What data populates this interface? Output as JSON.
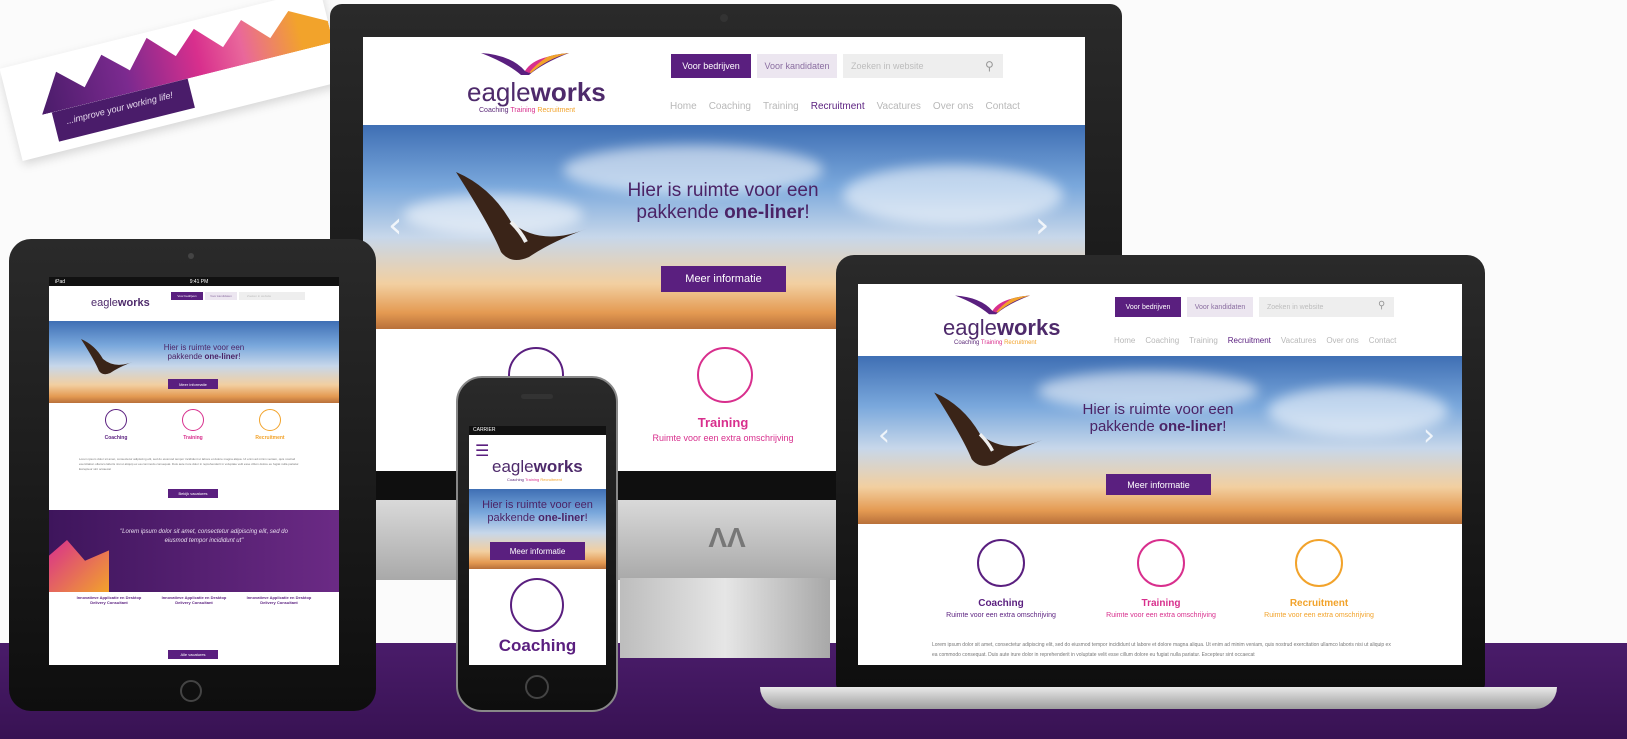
{
  "brand": {
    "name_light": "eagle",
    "name_bold": "works",
    "tag_coaching": "Coaching",
    "tag_training": "Training",
    "tag_recruitment": "Recruitment",
    "colors": {
      "purple": "#5a1f7f",
      "pink": "#d82f8d",
      "orange": "#f2a32b"
    }
  },
  "card": {
    "text": "...improve your working life!"
  },
  "header": {
    "btn_companies": "Voor bedrijven",
    "btn_candidates": "Voor kandidaten",
    "search_placeholder": "Zoeken in website",
    "search_icon": "search-icon"
  },
  "nav": {
    "home": "Home",
    "coaching": "Coaching",
    "training": "Training",
    "recruitment": "Recruitment",
    "vacatures": "Vacatures",
    "overons": "Over ons",
    "contact": "Contact"
  },
  "hero": {
    "line1": "Hier is ruimte voor een",
    "line2_pre": "pakkende ",
    "line2_bold": "one-liner",
    "line2_post": "!",
    "cta": "Meer informatie",
    "prev_icon": "chevron-left-icon",
    "next_icon": "chevron-right-icon"
  },
  "services": {
    "coaching_title": "Coaching",
    "training_title": "Training",
    "recruitment_title": "Recruitment",
    "desc": "Ruimte voor een extra omschrijving"
  },
  "body_text": "Lorem ipsum dolor sit amet, consectetur adipiscing elit, sed do eiusmod tempor incididunt ut labore et dolore magna aliqua. Ut enim ad minim veniam, quis nostrud exercitation ullamco laboris nisi ut aliquip ex ea commodo consequat. Duis aute irure dolor in reprehenderit in voluptate velit esse cillum dolore eu fugiat nulla pariatur. Excepteur sint occaecat",
  "tablet": {
    "status_left": "iPad",
    "status_time": "9:41 PM",
    "quote": "\"Lorem ipsum dolor sit amet, consectetur adipiscing elit, sed do eiusmod tempor incididunt ut\"",
    "read_more": "Bekijk vacatures",
    "jobs_title": "Innovatieve Applicatie en Desktop Delivery Consultant",
    "all_jobs": "Alle vacatures"
  },
  "phone": {
    "carrier": "CARRIER",
    "menu_icon": "hamburger-menu-icon"
  }
}
